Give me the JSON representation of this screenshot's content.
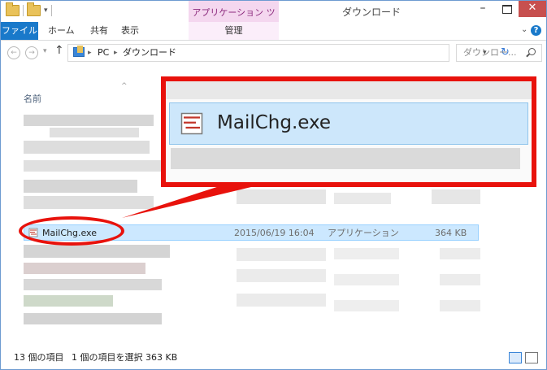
{
  "titlebar": {
    "contextual_tab": "アプリケーション ツール",
    "title": "ダウンロード",
    "minimize": "–",
    "close": "✕"
  },
  "ribbon": {
    "tabs": [
      "ファイル",
      "ホーム",
      "共有",
      "表示",
      "管理"
    ],
    "help": "?"
  },
  "address": {
    "pc": "PC",
    "folder": "ダウンロード",
    "search_placeholder": "ダウンロー..."
  },
  "columns": {
    "name": "名前"
  },
  "selected_file": {
    "name": "MailChg.exe",
    "date": "2015/06/19 16:04",
    "type": "アプリケーション",
    "size": "364 KB"
  },
  "callout": {
    "name": "MailChg.exe"
  },
  "status": {
    "count": "13 個の項目",
    "selection": "1 個の項目を選択  363 KB"
  },
  "colors": {
    "accent": "#1979ca",
    "highlight_red": "#e8120c",
    "selection": "#cce8ff"
  }
}
